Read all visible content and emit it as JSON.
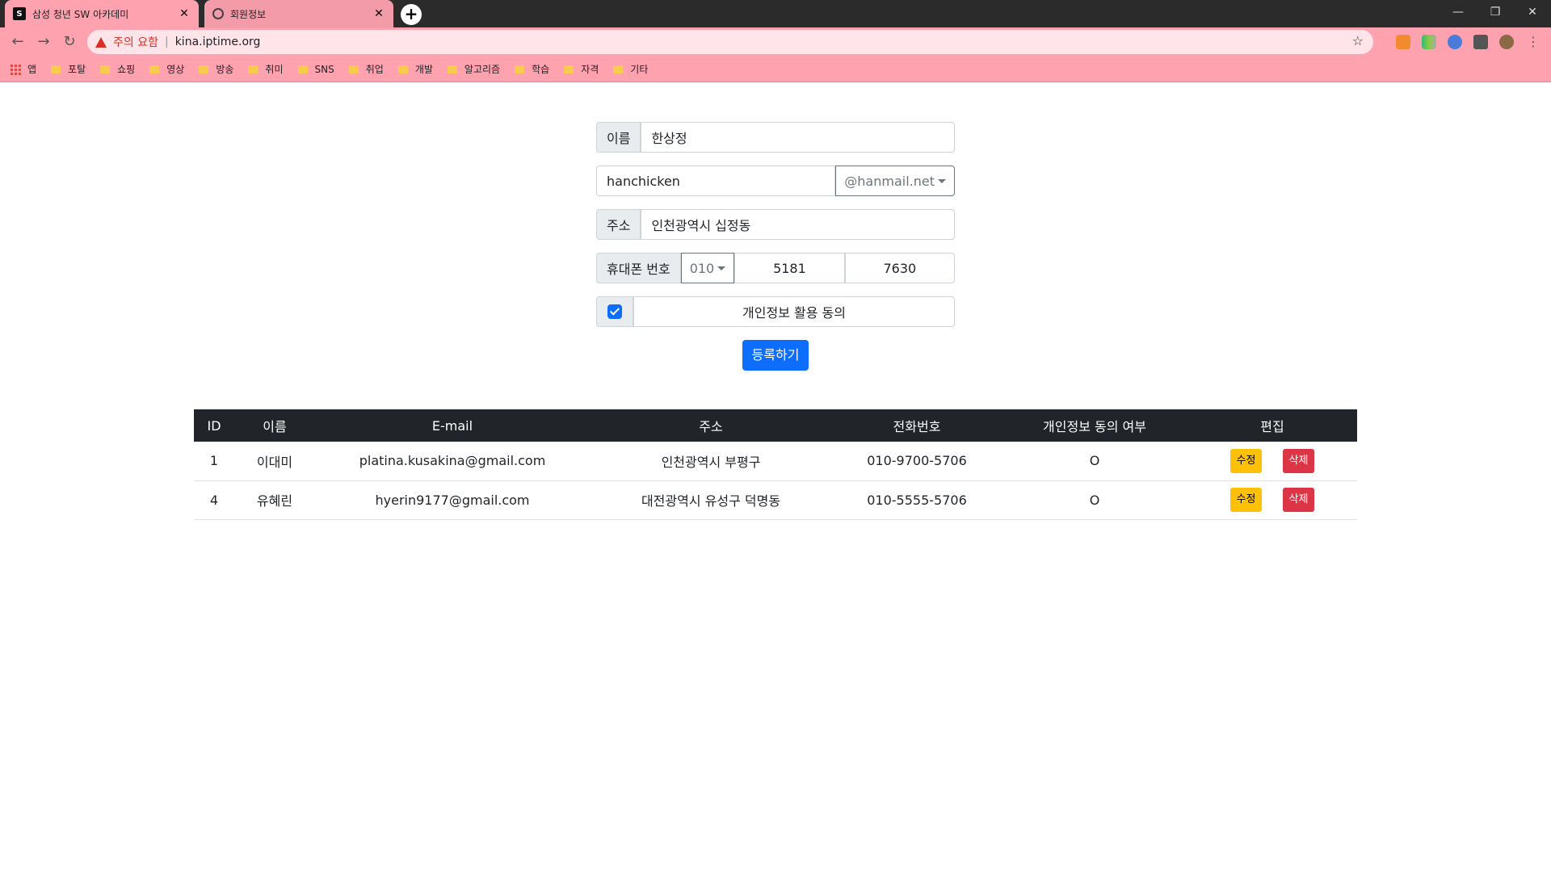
{
  "browser": {
    "tabs": [
      {
        "title": "삼성 청년 SW 아카데미",
        "active": true
      },
      {
        "title": "회원정보",
        "active": false
      }
    ],
    "new_tab": "+",
    "security_warning": "주의 요함",
    "separator": "|",
    "url": "kina.iptime.org",
    "bookmarks_apps": "앱",
    "bookmarks": [
      "포탈",
      "쇼핑",
      "영상",
      "방송",
      "취미",
      "SNS",
      "취업",
      "개발",
      "알고리즘",
      "학습",
      "자격",
      "기타"
    ],
    "chrome_color": "#ffa2b0"
  },
  "form": {
    "name_label": "이름",
    "name_value": "한상정",
    "email_id": "hanchicken",
    "email_domain": "@hanmail.net",
    "address_label": "주소",
    "address_value": "인천광역시 십정동",
    "phone_label": "휴대폰 번호",
    "phone_prefix": "010",
    "phone_mid": "5181",
    "phone_last": "7630",
    "consent_label": "개인정보 활용 동의",
    "consent_checked": true,
    "submit_label": "등록하기"
  },
  "table": {
    "headers": [
      "ID",
      "이름",
      "E-mail",
      "주소",
      "전화번호",
      "개인정보 동의 여부",
      "편집"
    ],
    "rows": [
      {
        "id": "1",
        "name": "이대미",
        "email": "platina.kusakina@gmail.com",
        "address": "인천광역시 부평구",
        "phone": "010-9700-5706",
        "consent": "O",
        "edit": "수정",
        "delete": "삭제"
      },
      {
        "id": "4",
        "name": "유혜린",
        "email": "hyerin9177@gmail.com",
        "address": "대전광역시 유성구 덕명동",
        "phone": "010-5555-5706",
        "consent": "O",
        "edit": "수정",
        "delete": "삭제"
      }
    ]
  }
}
